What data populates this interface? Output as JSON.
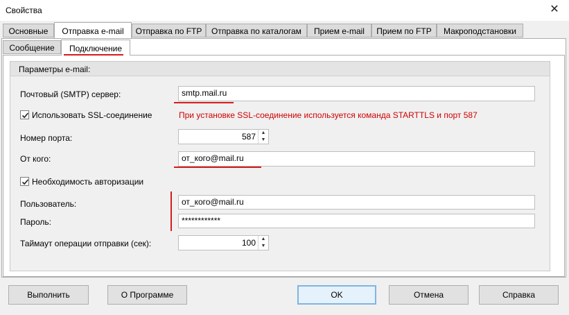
{
  "window": {
    "title": "Свойства"
  },
  "tabs_main": [
    "Основные",
    "Отправка e-mail",
    "Отправка по FTP",
    "Отправка по каталогам",
    "Прием e-mail",
    "Прием по FTP",
    "Макроподстановки"
  ],
  "active_main_tab": "Отправка e-mail",
  "tabs_sub": [
    "Сообщение",
    "Подключение"
  ],
  "active_sub_tab": "Подключение",
  "group": {
    "title": "Параметры e-mail:"
  },
  "form": {
    "smtp_label": "Почтовый (SMTP) сервер:",
    "smtp_value": "smtp.mail.ru",
    "ssl_label": "Использовать SSL-соединение",
    "ssl_checked": true,
    "ssl_note": "При установке SSL-соединение используется команда STARTTLS и порт 587",
    "port_label": "Номер порта:",
    "port_value": "587",
    "from_label": "От кого:",
    "from_value": "от_кого@mail.ru",
    "auth_label": "Необходимость авторизации",
    "auth_checked": true,
    "user_label": "Пользователь:",
    "user_value": "от_кого@mail.ru",
    "password_label": "Пароль:",
    "password_value": "************",
    "timeout_label": "Таймаут операции отправки (сек):",
    "timeout_value": "100"
  },
  "buttons": {
    "run": "Выполнить",
    "about": "О Программе",
    "ok": "OK",
    "cancel": "Отмена",
    "help": "Справка"
  },
  "colors": {
    "annotation_red": "#d61a1a",
    "note_red": "#d00000",
    "default_button_border": "#7fb5e2"
  }
}
